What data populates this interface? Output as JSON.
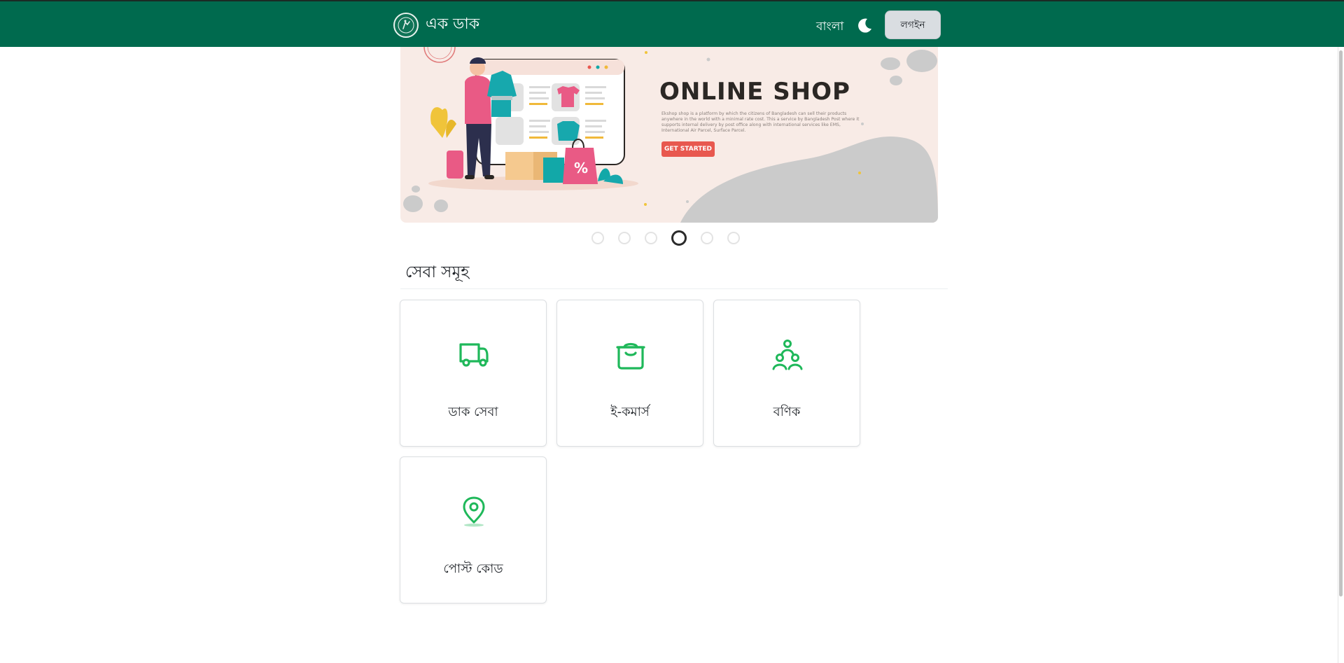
{
  "header": {
    "brand_name": "এক ডাক",
    "language_label": "বাংলা",
    "login_label": "লগইন",
    "logo_icon": "bangladesh-post-logo-icon",
    "theme_icon": "moon-icon",
    "bg_color": "#006a4e"
  },
  "banner": {
    "title": "ONLINE SHOP",
    "description": "Ekshop shop is a platform by which the citizens of Bangladesh can sell their products anywhere in the world with a minimal rate cost. This a service by Bangladesh Post where it supports internal delivery by post office along with international services like EMS, International Air Parcel, Surface Parcel.",
    "cta_label": "GET STARTED",
    "slides_total": 6,
    "active_slide": 4
  },
  "services": {
    "title": "সেবা সমূহ",
    "accent_color": "#1fb85a",
    "items": [
      {
        "label": "ডাক সেবা",
        "icon": "truck-icon"
      },
      {
        "label": "ই-কমার্স",
        "icon": "shopping-bag-icon"
      },
      {
        "label": "বণিক",
        "icon": "users-group-icon"
      },
      {
        "label": "পোস্ট কোড",
        "icon": "map-pin-icon"
      }
    ]
  }
}
